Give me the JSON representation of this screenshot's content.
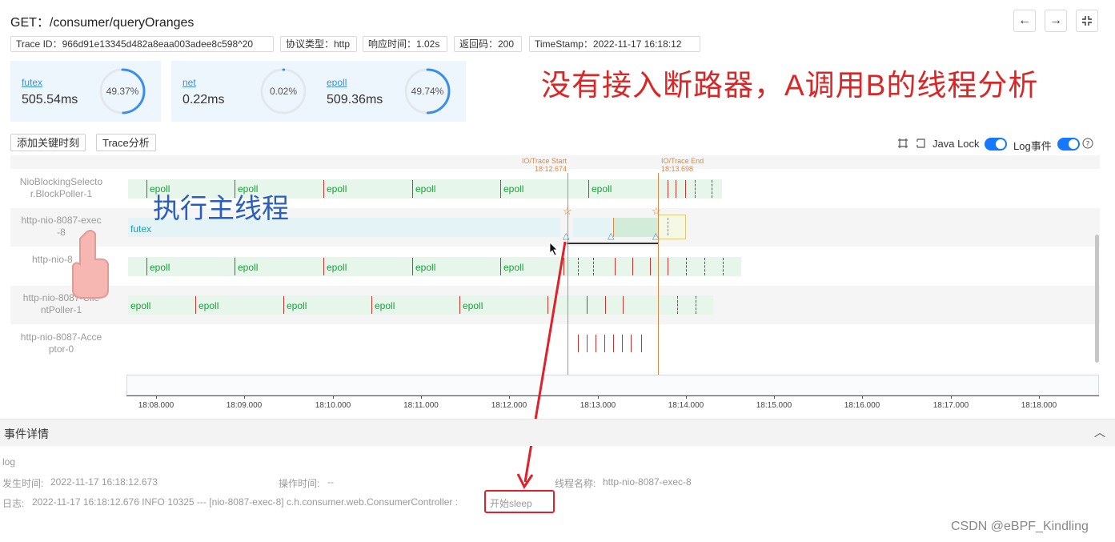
{
  "header": {
    "title": "GET：/consumer/queryOranges",
    "tags": [
      "Trace ID：966d91e13345d482a8eaa003adee8c598^20",
      "协议类型：http",
      "响应时间：1.02s",
      "返回码：200",
      "TimeStamp：2022-11-17 16:18:12"
    ]
  },
  "cards": [
    {
      "label": "futex",
      "value": "505.54ms",
      "pct": "49.37%",
      "fraction": 0.4937
    },
    {
      "label": "net",
      "value": "0.22ms",
      "pct": "0.02%",
      "fraction": 0.0002
    },
    {
      "label": "epoll",
      "value": "509.36ms",
      "pct": "49.74%",
      "fraction": 0.4974
    }
  ],
  "annotation": "没有接入断路器，A调用B的线程分析",
  "overlay_text": "执行主线程",
  "toolbar": {
    "add_key_moment": "添加关键时刻",
    "trace_analysis": "Trace分析",
    "java_lock": "Java Lock",
    "log_event": "Log事件"
  },
  "markers": {
    "start_label": "IO/Trace Start",
    "start_time": "18:12.674",
    "end_label": "IO/Trace End",
    "end_time": "18:13.698"
  },
  "threads": [
    {
      "name_l1": "NioBlockingSelecto",
      "name_l2": "r.BlockPoller-1"
    },
    {
      "name_l1": "http-nio-8087-exec",
      "name_l2": "-8"
    },
    {
      "name_l1": "http-nio-8",
      "name_l2": ""
    },
    {
      "name_l1": "http-nio-8087-Clie",
      "name_l2": "ntPoller-1"
    },
    {
      "name_l1": "http-nio-8087-Acce",
      "name_l2": "ptor-0"
    }
  ],
  "event_labels": {
    "epoll": "epoll",
    "futex": "futex"
  },
  "axis_ticks": [
    "18:08.000",
    "18:09.000",
    "18:10.000",
    "18:11.000",
    "18:12.000",
    "18:13.000",
    "18:14.000",
    "18:15.000",
    "18:16.000",
    "18:17.000",
    "18:18.000"
  ],
  "events": {
    "title": "事件详情",
    "type": "log",
    "occur_label": "发生时间:",
    "occur_value": "2022-11-17 16:18:12.673",
    "op_label": "操作时间:",
    "op_value": "--",
    "thread_label": "线程名称:",
    "thread_value": "http-nio-8087-exec-8",
    "log_label": "日志:",
    "log_value": "2022-11-17 16:18:12.676 INFO 10325 --- [nio-8087-exec-8] c.h.consumer.web.ConsumerController :",
    "log_highlight": "开始sleep"
  },
  "watermark": "CSDN @eBPF_Kindling",
  "colors": {
    "accent": "#1677ff",
    "annotation": "#d92626",
    "epoll": "#18a33a",
    "marker": "#d7894b",
    "arrow": "#e0202a"
  }
}
